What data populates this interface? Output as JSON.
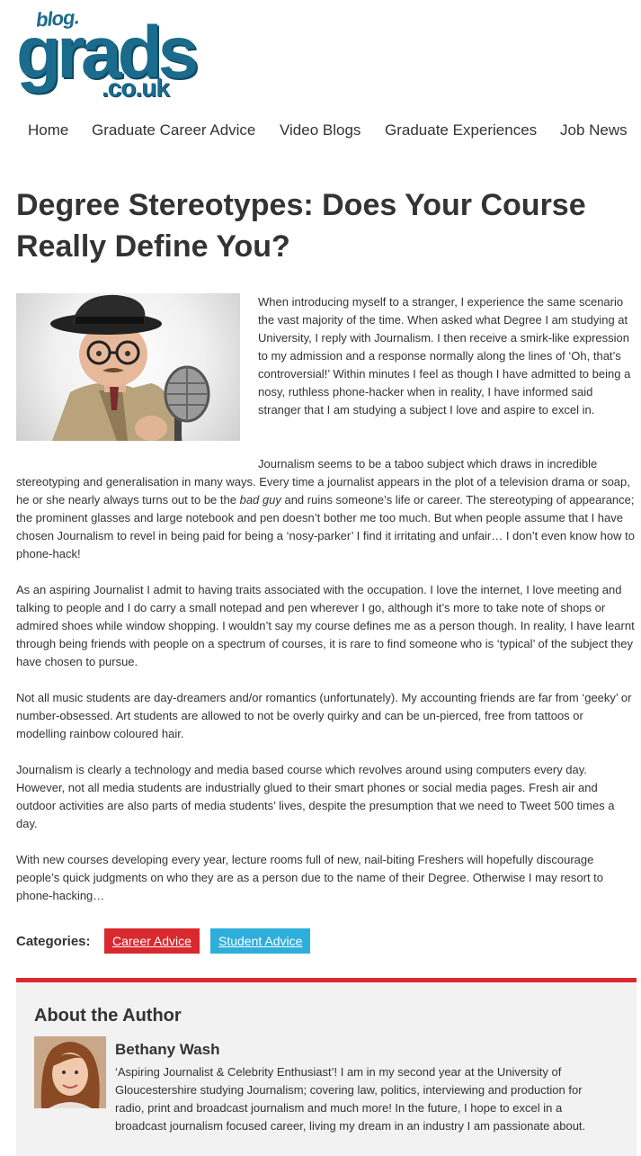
{
  "logo": {
    "blog": "blog.",
    "grads": "grads",
    "couk": ".co.uk"
  },
  "nav": {
    "items": [
      {
        "label": "Home"
      },
      {
        "label": "Graduate Career Advice"
      },
      {
        "label": "Video Blogs"
      },
      {
        "label": "Graduate Experiences"
      },
      {
        "label": "Job News"
      }
    ]
  },
  "article": {
    "title": "Degree Stereotypes: Does Your Course Really Define You?",
    "p1": "When introducing myself to a stranger, I experience the same scenario the vast majority of the time. When asked what Degree I am studying at University, I reply with Journalism. I then receive a smirk-like expression to my admission and a response normally along the lines of ‘Oh, that’s controversial!’ Within minutes I feel as though I have admitted to being a nosy, ruthless phone-hacker when in reality, I have informed said stranger that I am studying a subject I love and aspire to excel in.",
    "p2_a": "Journalism seems to be a taboo subject which draws in incredible stereotyping and generalisation in many ways. Every time a journalist appears in the plot of a television drama or soap, he or she nearly always turns out to be the ",
    "p2_em": "bad guy",
    "p2_b": " and ruins someone’s life or career. The stereotyping of appearance; the prominent glasses and large notebook and pen doesn’t bother me too much. But when people assume that I have chosen Journalism to revel in being paid for being a ‘nosy-parker’ I find it irritating and unfair… I don’t even know how to phone-hack!",
    "p3": "As an aspiring Journalist I admit to having traits associated with the occupation. I love the internet, I love meeting and talking to people and I do carry a small notepad and pen wherever I go, although it’s more to take note of shops or admired shoes while window shopping. I wouldn’t say my course defines me as a person though. In reality, I have learnt through being friends with people on a spectrum of courses, it is rare to find someone who is ‘typical’ of the subject they have chosen to pursue.",
    "p4": "Not all music students are day-dreamers and/or romantics (unfortunately). My accounting friends are far from ‘geeky’ or number-obsessed. Art students are allowed to not be overly quirky and can be un-pierced, free from tattoos or modelling rainbow coloured hair.",
    "p5": "Journalism is clearly a technology and media based course which revolves around using computers every day. However, not all media students are industrially glued to their smart phones or social media pages. Fresh air and outdoor activities are also parts of media students’ lives, despite the presumption that we need to Tweet 500 times a day.",
    "p6": "With new courses developing every year, lecture rooms full of new, nail-biting Freshers will hopefully discourage people’s quick judgments on who they are as a person due to the name of their Degree. Otherwise I may resort to phone-hacking…"
  },
  "categories": {
    "label": "Categories:",
    "items": [
      {
        "label": "Career Advice",
        "color": "#d9292f"
      },
      {
        "label": "Student Advice",
        "color": "#2eaedb"
      }
    ]
  },
  "author": {
    "heading": "About the Author",
    "name": "Bethany Wash",
    "bio": "‘Aspiring Journalist & Celebrity Enthusiast’! I am in my second year at the University of Gloucestershire studying Journalism; covering law, politics, interviewing and production for radio, print and broadcast journalism and much more! In the future, I hope to excel in a broadcast journalism focused career, living my dream in an industry I am passionate about."
  },
  "colors": {
    "brand": "#1a6b8c",
    "accent_red": "#d9292f",
    "accent_blue": "#2eaedb",
    "text": "#333333"
  }
}
